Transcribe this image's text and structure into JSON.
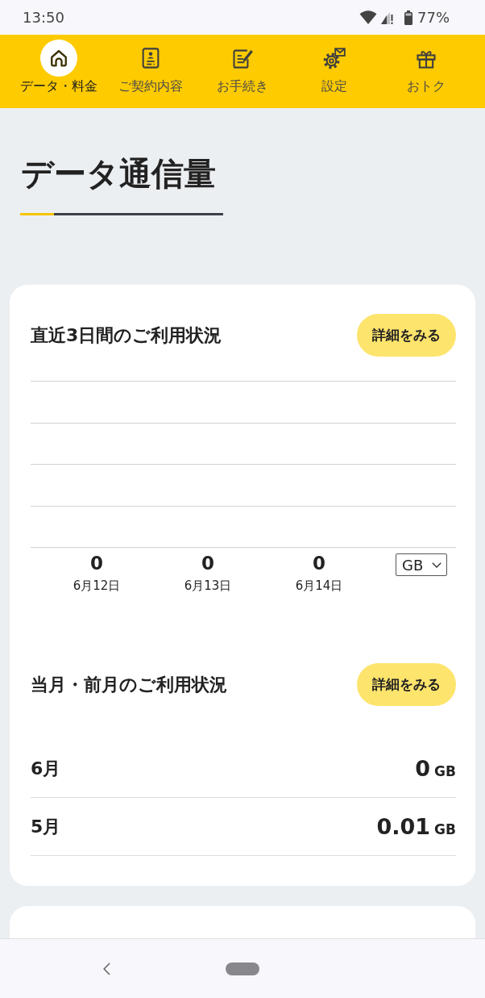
{
  "status_bar": {
    "time": "13:50",
    "battery": "77%"
  },
  "nav_tabs": [
    {
      "label": "データ・料金",
      "selected": true
    },
    {
      "label": "ご契約内容",
      "selected": false
    },
    {
      "label": "お手続き",
      "selected": false
    },
    {
      "label": "設定",
      "selected": false
    },
    {
      "label": "おトク",
      "selected": false
    }
  ],
  "page_title": "データ通信量",
  "usage_card": {
    "sections": [
      {
        "kind": "daily",
        "title": "直近3日間のご利用状況",
        "button": "詳細をみる",
        "days": [
          {
            "value": "0",
            "date": "6月12日"
          },
          {
            "value": "0",
            "date": "6月13日"
          },
          {
            "value": "0",
            "date": "6月14日"
          }
        ],
        "unit_select": {
          "value": "GB"
        }
      },
      {
        "kind": "monthly",
        "title": "当月・前月のご利用状況",
        "button": "詳細をみる",
        "rows": [
          {
            "month": "6月",
            "value": "0",
            "unit": "GB"
          },
          {
            "month": "5月",
            "value": "0.01",
            "unit": "GB"
          }
        ]
      }
    ]
  }
}
